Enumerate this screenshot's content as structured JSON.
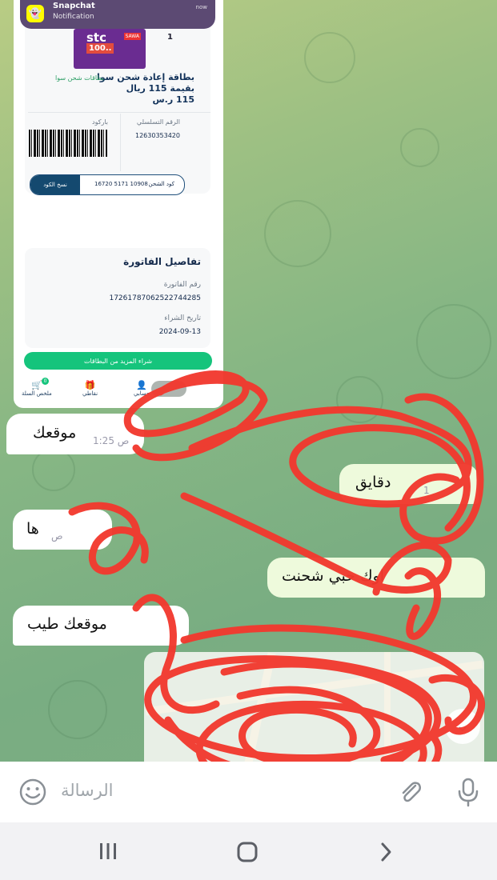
{
  "notification": {
    "app": "Snapchat",
    "text": "Notification",
    "time": "now"
  },
  "screenshot": {
    "brand": "stc",
    "brand_tag": "SAWA",
    "card_value": "100..",
    "quantity": "1",
    "product_line1": "بطاقة إعادة شحن سوا",
    "product_line2": "بقيمة 115 ريال",
    "product_price": "115 ر.س",
    "product_category": "بطاقات شحن سوا",
    "serial_label": "الرقم التسلسلي",
    "serial_value": "12630353420",
    "barcode_label": "باركود",
    "charge_code_label": "كود الشحن",
    "charge_code_value": "16720 5171 10908",
    "copy_code_label": "نسخ الكود",
    "invoice_title": "تفاصيل الفاتورة",
    "invoice_number_label": "رقم الفاتورة",
    "invoice_number": "17261787062522744285",
    "purchase_date_label": "تاريخ الشراء",
    "purchase_date": "2024-09-13",
    "buy_more": "شراء المزيد من البطاقات",
    "nav": {
      "cart": "ملخص السلة",
      "points": "نقاطي",
      "account": "حسابي",
      "cart_badge": "0"
    }
  },
  "messages": [
    {
      "dir": "in",
      "text": "موقعك",
      "time": "1:25 ص"
    },
    {
      "dir": "out",
      "text": "دقايق",
      "time": "1"
    },
    {
      "dir": "in",
      "text": "ها",
      "time": "ص"
    },
    {
      "dir": "out",
      "text": "اوك حبي شحنت",
      "time": ""
    },
    {
      "dir": "in",
      "text": "موقعك طيب",
      "time": ""
    }
  ],
  "composer": {
    "placeholder": "الرسالة"
  },
  "colors": {
    "accent_green": "#15c47c",
    "stc_purple": "#6a2c91",
    "scribble": "#f2392e",
    "bubble_out": "#eefadc"
  }
}
